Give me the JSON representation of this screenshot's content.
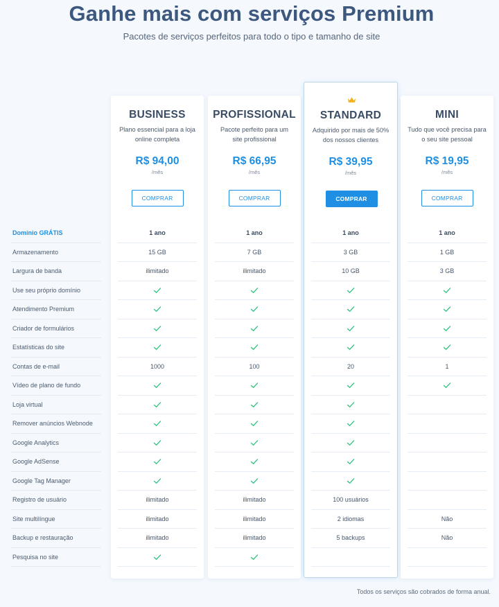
{
  "hero": {
    "title": "Ganhe mais com serviços Premium",
    "subtitle": "Pacotes de serviços perfeitos para todo o tipo e tamanho de site"
  },
  "colors": {
    "accent": "#1e8fe2",
    "check": "#2ec27e",
    "crown": "#f3b21b",
    "title": "#3d587e"
  },
  "plans": [
    {
      "id": "business",
      "name": "BUSINESS",
      "description": "Plano essencial para a loja online completa",
      "price": "R$ 94,00",
      "period": "/mês",
      "button": "COMPRAR",
      "highlight": false,
      "values": [
        "1 ano",
        "15 GB",
        "ilimitado",
        "check",
        "check",
        "check",
        "check",
        "1000",
        "check",
        "check",
        "check",
        "check",
        "check",
        "check",
        "ilimitado",
        "ilimitado",
        "ilimitado",
        "check"
      ]
    },
    {
      "id": "profissional",
      "name": "PROFISSIONAL",
      "description": "Pacote perfeito para um site profissional",
      "price": "R$ 66,95",
      "period": "/mês",
      "button": "COMPRAR",
      "highlight": false,
      "values": [
        "1 ano",
        "7 GB",
        "ilimitado",
        "check",
        "check",
        "check",
        "check",
        "100",
        "check",
        "check",
        "check",
        "check",
        "check",
        "check",
        "ilimitado",
        "ilimitado",
        "ilimitado",
        "check"
      ]
    },
    {
      "id": "standard",
      "name": "STANDARD",
      "description": "Adquirido por mais de 50% dos nossos clientes",
      "price": "R$ 39,95",
      "period": "/mês",
      "button": "COMPRAR",
      "highlight": true,
      "crown_icon": "crown-icon",
      "values": [
        "1 ano",
        "3 GB",
        "10 GB",
        "check",
        "check",
        "check",
        "check",
        "20",
        "check",
        "check",
        "check",
        "check",
        "check",
        "check",
        "100 usuários",
        "2 idiomas",
        "5 backups",
        ""
      ]
    },
    {
      "id": "mini",
      "name": "MINI",
      "description": "Tudo que você precisa para o seu site pessoal",
      "price": "R$ 19,95",
      "period": "/mês",
      "button": "COMPRAR",
      "highlight": false,
      "values": [
        "1 ano",
        "1 GB",
        "3 GB",
        "check",
        "check",
        "check",
        "check",
        "1",
        "check",
        "",
        "",
        "",
        "",
        "",
        "",
        "Não",
        "Não",
        ""
      ]
    }
  ],
  "features": [
    "Domínio GRÁTIS",
    "Armazenamento",
    "Largura de banda",
    "Use seu próprio domínio",
    "Atendimento Premium",
    "Criador de formulários",
    "Estatísticas do site",
    "Contas de e-mail",
    "Vídeo de plano de fundo",
    "Loja virtual",
    "Remover anúncios Webnode",
    "Google Analytics",
    "Google AdSense",
    "Google Tag Manager",
    "Registro de usuário",
    "Site multilíngue",
    "Backup e restauração",
    "Pesquisa no site"
  ],
  "footnote": "Todos os serviços são cobrados de forma anual."
}
